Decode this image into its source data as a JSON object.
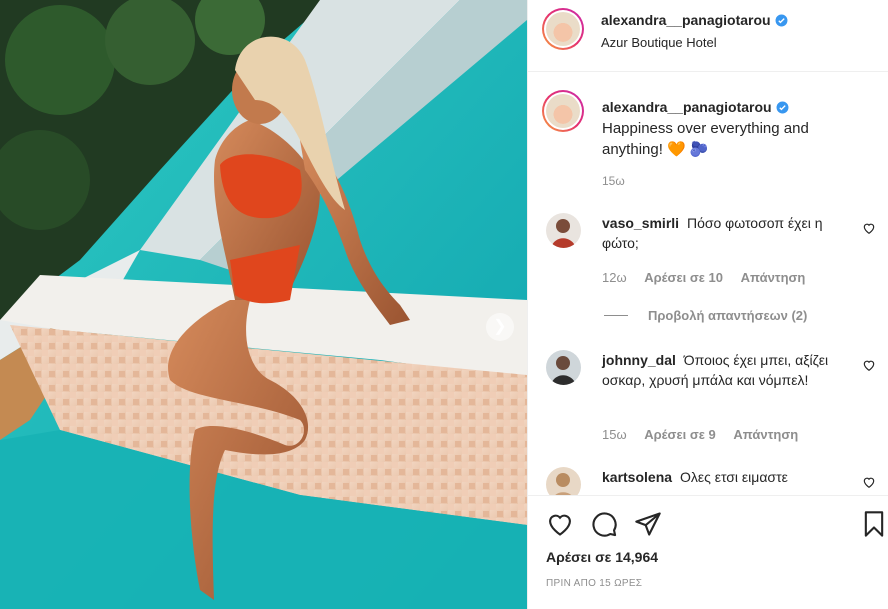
{
  "post": {
    "username": "alexandra__panagiotarou",
    "location": "Azur Boutique Hotel",
    "caption": "Happiness over everything and anything! 🧡 🫐",
    "caption_time": "15ω"
  },
  "comments": [
    {
      "username": "vaso_smirli",
      "text": "Πόσο φωτοσοπ έχει η φώτο;",
      "time": "12ω",
      "likes": "Αρέσει σε 10",
      "reply": "Απάντηση"
    },
    {
      "username": "johnny_dal",
      "text": "Όποιος έχει μπει, αξίζει οσκαρ, χρυσή μπάλα και νόμπελ!",
      "time": "15ω",
      "likes": "Αρέσει σε 9",
      "reply": "Απάντηση"
    },
    {
      "username": "kartsolena",
      "text": "Ολες ετσι ειμαστε"
    }
  ],
  "view_replies": "Προβολή απαντήσεων (2)",
  "likes_summary": "Αρέσει σε 14,964",
  "posted_ago": "ΠΡΙΝ ΑΠΟ 15 ΩΡΕΣ",
  "icons": {
    "verified": "verified-badge-icon",
    "like": "heart-icon",
    "comment": "comment-icon",
    "share": "share-icon",
    "save": "bookmark-icon",
    "next": "chevron-right-icon"
  },
  "colors": {
    "verified": "#3897f0",
    "muted": "#8e8e8e",
    "text": "#262626",
    "pool": "#1fb6b4",
    "bikini": "#e0461d"
  }
}
